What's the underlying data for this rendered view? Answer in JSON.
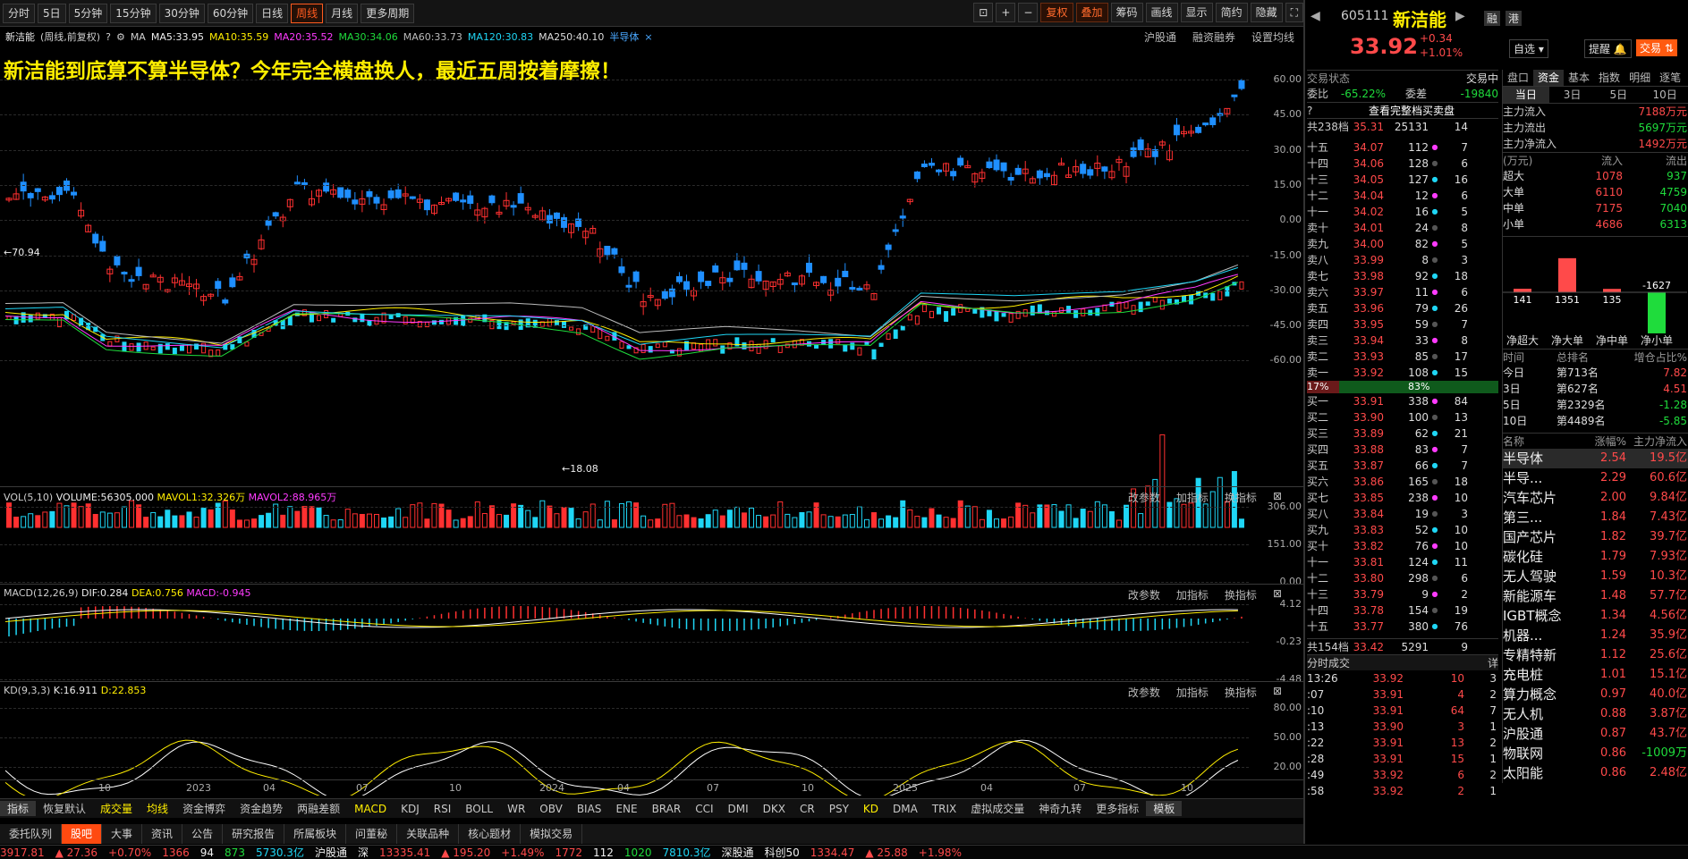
{
  "toolbar": {
    "periods": [
      "分时",
      "5日",
      "5分钟",
      "15分钟",
      "30分钟",
      "60分钟",
      "日线",
      "周线",
      "月线",
      "更多周期"
    ],
    "active": "周线",
    "right_buttons": [
      "复权",
      "叠加",
      "筹码",
      "画线",
      "显示",
      "简约",
      "隐藏"
    ]
  },
  "ma_bar": {
    "name": "新洁能",
    "mode": "(周线,前复权)",
    "ma": "MA",
    "ma5": "MA5:33.95",
    "ma10": "MA10:35.59",
    "ma20": "MA20:35.52",
    "ma30": "MA30:34.06",
    "ma60": "MA60:33.73",
    "ma120": "MA120:30.83",
    "ma250": "MA250:40.10",
    "concept": "半导体",
    "links": [
      "沪股通",
      "融资融券",
      "设置均线"
    ]
  },
  "headline": "新洁能到底算不算半导体？今年完全横盘换人，最近五周按着摩擦！",
  "main_chart": {
    "y_ticks": [
      "60.00",
      "45.00",
      "30.00",
      "15.00",
      "0.00",
      "-15.00",
      "-30.00",
      "-45.00",
      "-60.00"
    ],
    "high_label": "70.94",
    "low_label": "18.08"
  },
  "vol_panel": {
    "title": "VOL(5,10)",
    "volume": "VOLUME:56305.000",
    "mavol1": "MAVOL1:32.326万",
    "mavol2": "MAVOL2:88.965万",
    "y_ticks": [
      "306.00",
      "151.00",
      "0.00"
    ],
    "tools": [
      "改参数",
      "加指标",
      "换指标"
    ]
  },
  "macd_panel": {
    "title": "MACD(12,26,9)",
    "dif": "DIF:0.284",
    "dea": "DEA:0.756",
    "macd": "MACD:-0.945",
    "y_ticks": [
      "4.12",
      "-0.23",
      "-4.48"
    ]
  },
  "kd_panel": {
    "title": "KD(9,3,3)",
    "k": "K:16.911",
    "d": "D:22.853",
    "y_ticks": [
      "80.00",
      "50.00",
      "20.00"
    ]
  },
  "x_axis": [
    "10",
    "2023",
    "04",
    "07",
    "10",
    "2024",
    "04",
    "07",
    "10",
    "2025",
    "04",
    "07",
    "10"
  ],
  "index_tabs": [
    "指标",
    "恢复默认",
    "成交量",
    "均线",
    "资金博弈",
    "资金趋势",
    "两融差额",
    "MACD",
    "KDJ",
    "RSI",
    "BOLL",
    "WR",
    "OBV",
    "BIAS",
    "ENE",
    "BRAR",
    "CCI",
    "DMI",
    "DKX",
    "CR",
    "PSY",
    "KD",
    "DMA",
    "TRIX",
    "虚拟成交量",
    "神奇九转",
    "更多指标",
    "模板"
  ],
  "bottom_tabs": [
    "委托队列",
    "股吧",
    "大事",
    "资讯",
    "公告",
    "研究报告",
    "所属板块",
    "问董秘",
    "关联品种",
    "核心题材",
    "模拟交易"
  ],
  "status": {
    "sh": "3917.81",
    "sh_chg": "▲ 27.36",
    "sh_pct": "+0.70%",
    "sh_up": "1366",
    "sh_flat": "94",
    "sh_down": "873",
    "sh_amt": "5730.3亿",
    "hgt": "沪股通",
    "sz_label": "深",
    "sz": "13335.41",
    "sz_chg": "▲ 195.20",
    "sz_pct": "+1.49%",
    "sz_up": "1772",
    "sz_flat": "112",
    "sz_down": "1020",
    "sz_amt": "7810.3亿",
    "sgt": "深股通",
    "kc_label": "科创50",
    "kc": "1334.47",
    "kc_chg": "▲ 25.88",
    "kc_pct": "+1.98%"
  },
  "stock": {
    "code": "605111",
    "name": "新洁能",
    "price": "33.92",
    "change": "+0.34",
    "pct": "+1.01%",
    "tags": [
      "融",
      "港"
    ],
    "buttons": [
      "自选",
      "提醒",
      "交易"
    ]
  },
  "orderbook": {
    "state": "交易状态",
    "state_val": "交易中",
    "wb_label": "委比",
    "wb": "-65.22%",
    "wc_label": "委差",
    "wc": "-19840",
    "view_all": "查看完整档买卖盘",
    "total_sell": {
      "label": "共238档",
      "price": "35.31",
      "vol": "25131",
      "n": "14"
    },
    "sells": [
      [
        "十五",
        "34.07",
        "112",
        "7"
      ],
      [
        "十四",
        "34.06",
        "128",
        "6"
      ],
      [
        "十三",
        "34.05",
        "127",
        "16"
      ],
      [
        "十二",
        "34.04",
        "12",
        "6"
      ],
      [
        "十一",
        "34.02",
        "16",
        "5"
      ],
      [
        "卖十",
        "34.01",
        "24",
        "8"
      ],
      [
        "卖九",
        "34.00",
        "82",
        "5"
      ],
      [
        "卖八",
        "33.99",
        "8",
        "3"
      ],
      [
        "卖七",
        "33.98",
        "92",
        "18"
      ],
      [
        "卖六",
        "33.97",
        "11",
        "6"
      ],
      [
        "卖五",
        "33.96",
        "79",
        "26"
      ],
      [
        "卖四",
        "33.95",
        "59",
        "7"
      ],
      [
        "卖三",
        "33.94",
        "33",
        "8"
      ],
      [
        "卖二",
        "33.93",
        "85",
        "17"
      ],
      [
        "卖一",
        "33.92",
        "108",
        "15"
      ]
    ],
    "ratio_sell": "17%",
    "ratio_buy": "83%",
    "buys": [
      [
        "买一",
        "33.91",
        "338",
        "84"
      ],
      [
        "买二",
        "33.90",
        "100",
        "13"
      ],
      [
        "买三",
        "33.89",
        "62",
        "21"
      ],
      [
        "买四",
        "33.88",
        "83",
        "7"
      ],
      [
        "买五",
        "33.87",
        "66",
        "7"
      ],
      [
        "买六",
        "33.86",
        "165",
        "18"
      ],
      [
        "买七",
        "33.85",
        "238",
        "10"
      ],
      [
        "买八",
        "33.84",
        "19",
        "3"
      ],
      [
        "买九",
        "33.83",
        "52",
        "10"
      ],
      [
        "买十",
        "33.82",
        "76",
        "10"
      ],
      [
        "十一",
        "33.81",
        "124",
        "11"
      ],
      [
        "十二",
        "33.80",
        "298",
        "6"
      ],
      [
        "十三",
        "33.79",
        "9",
        "2"
      ],
      [
        "十四",
        "33.78",
        "154",
        "19"
      ],
      [
        "十五",
        "33.77",
        "380",
        "76"
      ]
    ],
    "total_buy": {
      "label": "共154档",
      "price": "33.42",
      "vol": "5291",
      "n": "9"
    }
  },
  "trades": {
    "title": "分时成交",
    "detail": "详",
    "rows": [
      [
        "13:26",
        "33.92",
        "10",
        "3"
      ],
      [
        ":07",
        "33.91",
        "4",
        "2"
      ],
      [
        ":10",
        "33.91",
        "64",
        "7"
      ],
      [
        ":13",
        "33.90",
        "3",
        "1"
      ],
      [
        ":22",
        "33.91",
        "13",
        "2"
      ],
      [
        ":28",
        "33.91",
        "15",
        "1"
      ],
      [
        ":49",
        "33.92",
        "6",
        "2"
      ],
      [
        ":58",
        "33.92",
        "2",
        "1"
      ]
    ]
  },
  "fund": {
    "tabs": [
      "盘口",
      "资金",
      "基本",
      "指数",
      "明细",
      "逐笔"
    ],
    "period_tabs": [
      "当日",
      "3日",
      "5日",
      "10日"
    ],
    "main_in_label": "主力流入",
    "main_in": "7188万元",
    "main_out_label": "主力流出",
    "main_out": "5697万元",
    "net_label": "主力净流入",
    "net": "1492万元",
    "table_head": [
      "(万元)",
      "流入",
      "流出"
    ],
    "table": [
      [
        "超大",
        "1078",
        "937"
      ],
      [
        "大单",
        "6110",
        "4759"
      ],
      [
        "中单",
        "7175",
        "7040"
      ],
      [
        "小单",
        "4686",
        "6313"
      ]
    ],
    "bars": [
      {
        "label": "净超大",
        "value": 141
      },
      {
        "label": "净大单",
        "value": 1351
      },
      {
        "label": "净中单",
        "value": 135
      },
      {
        "label": "净小单",
        "value": -1627
      }
    ],
    "rank_head": [
      "时间",
      "总排名",
      "增仓占比%"
    ],
    "ranks": [
      [
        "今日",
        "第713名",
        "7.82"
      ],
      [
        "3日",
        "第627名",
        "4.51"
      ],
      [
        "5日",
        "第2329名",
        "-1.28"
      ],
      [
        "10日",
        "第4489名",
        "-5.85"
      ]
    ]
  },
  "sectors": {
    "head": [
      "名称",
      "涨幅%",
      "主力净流入"
    ],
    "rows": [
      [
        "半导体",
        "2.54",
        "19.5亿"
      ],
      [
        "半导...",
        "2.29",
        "60.6亿"
      ],
      [
        "汽车芯片",
        "2.00",
        "9.84亿"
      ],
      [
        "第三...",
        "1.84",
        "7.43亿"
      ],
      [
        "国产芯片",
        "1.82",
        "39.7亿"
      ],
      [
        "碳化硅",
        "1.79",
        "7.93亿"
      ],
      [
        "无人驾驶",
        "1.59",
        "10.3亿"
      ],
      [
        "新能源车",
        "1.48",
        "57.7亿"
      ],
      [
        "IGBT概念",
        "1.34",
        "4.56亿"
      ],
      [
        "机器...",
        "1.24",
        "35.9亿"
      ],
      [
        "专精特新",
        "1.12",
        "25.6亿"
      ],
      [
        "充电桩",
        "1.01",
        "15.1亿"
      ],
      [
        "算力概念",
        "0.97",
        "40.0亿"
      ],
      [
        "无人机",
        "0.88",
        "3.87亿"
      ],
      [
        "沪股通",
        "0.87",
        "43.7亿"
      ],
      [
        "物联网",
        "0.86",
        "-1009万"
      ],
      [
        "太阳能",
        "0.86",
        "2.48亿"
      ]
    ]
  }
}
